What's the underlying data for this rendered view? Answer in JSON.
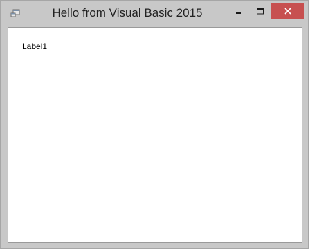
{
  "window": {
    "title": "Hello from Visual Basic 2015",
    "frame_color": "#c8c8c8",
    "close_button_color": "#c75050",
    "client_background": "#ffffff",
    "icon": "form-icon"
  },
  "titlebar_buttons": {
    "minimize_icon": "minimize-icon",
    "maximize_icon": "maximize-icon",
    "close_icon": "close-icon"
  },
  "form": {
    "label1": "Label1"
  }
}
